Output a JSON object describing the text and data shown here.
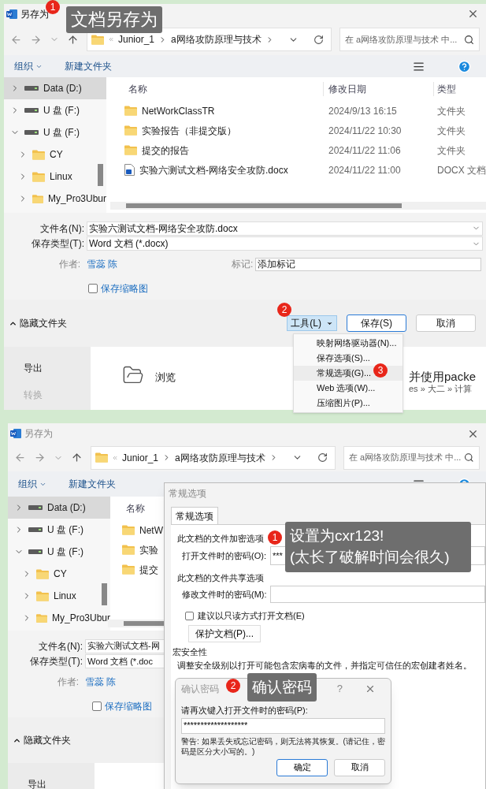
{
  "step1": {
    "dialog": {
      "title": "另存为",
      "path": [
        "Junior_1",
        "a网络攻防原理与技术"
      ],
      "search_placeholder": "在 a网络攻防原理与技术 中...",
      "organize": "组织",
      "new_folder": "新建文件夹",
      "tree": [
        {
          "label": "Data (D:)",
          "kind": "drive",
          "selected": true,
          "expanded": false
        },
        {
          "label": "U 盘 (F:)",
          "kind": "drive",
          "selected": false,
          "expanded": false
        },
        {
          "label": "U 盘 (F:)",
          "kind": "drive",
          "selected": false,
          "expanded": true,
          "children": [
            {
              "label": "CY",
              "kind": "folder",
              "selected": false,
              "expanded": false
            },
            {
              "label": "Linux",
              "kind": "folder",
              "selected": false,
              "expanded": false
            },
            {
              "label": "My_Pro3Ubur",
              "kind": "folder",
              "selected": false,
              "expanded": false
            }
          ]
        }
      ],
      "columns": [
        "名称",
        "修改日期",
        "类型"
      ],
      "files": [
        {
          "kind": "folder",
          "name": "NetWorkClassTR",
          "date": "2024/9/13 16:15",
          "type": "文件夹"
        },
        {
          "kind": "folder",
          "name": "实验报告（非提交版）",
          "date": "2024/11/22 10:30",
          "type": "文件夹"
        },
        {
          "kind": "folder",
          "name": "提交的报告",
          "date": "2024/11/22 11:06",
          "type": "文件夹"
        },
        {
          "kind": "docx",
          "name": "实验六测试文档-网络安全攻防.docx",
          "date": "2024/11/22 11:00",
          "type": "DOCX 文档"
        }
      ],
      "filename_label": "文件名(N):",
      "filename": "实验六测试文档-网络安全攻防.docx",
      "filetype_label": "保存类型(T):",
      "filetype": "Word 文档 (*.docx)",
      "author_label": "作者:",
      "author": "雪蕊 陈",
      "tags_label": "标记:",
      "tags_placeholder": "添加标记",
      "thumbnail": {
        "label": "保存缩略图",
        "checked": false
      },
      "hide_folders": "隐藏文件夹",
      "tools": "工具(L)",
      "save": "保存(S)",
      "cancel": "取消"
    },
    "background": {
      "menu": [
        {
          "label": "导出",
          "disabled": false
        },
        {
          "label": "转换",
          "disabled": true
        }
      ],
      "browse": "浏览",
      "recent_title": "并使用packe",
      "recent_path": "es » 大二 » 计算"
    },
    "tools_menu": [
      {
        "label": "映射网络驱动器(N)...",
        "selected": false
      },
      {
        "label": "保存选项(S)...",
        "selected": false
      },
      {
        "label": "常规选项(G)...",
        "selected": true
      },
      {
        "label": "Web 选项(W)...",
        "selected": false
      },
      {
        "label": "压缩图片(P)...",
        "selected": false
      }
    ],
    "callouts": [
      {
        "number": "1",
        "lines": [
          "文档另存为"
        ]
      },
      {
        "number": "2"
      },
      {
        "number": "3"
      }
    ]
  },
  "step2": {
    "dialog": {
      "title": "另存为",
      "path": [
        "Junior_1",
        "a网络攻防原理与技术"
      ],
      "search_placeholder": "在 a网络攻防原理与技术 中...",
      "organize": "组织",
      "new_folder": "新建文件夹",
      "tree": [
        {
          "label": "Data (D:)",
          "kind": "drive",
          "selected": true,
          "expanded": false
        },
        {
          "label": "U 盘 (F:)",
          "kind": "drive",
          "selected": false,
          "expanded": false
        },
        {
          "label": "U 盘 (F:)",
          "kind": "drive",
          "selected": false,
          "expanded": true,
          "children": [
            {
              "label": "CY",
              "kind": "folder",
              "selected": false,
              "expanded": false
            },
            {
              "label": "Linux",
              "kind": "folder",
              "selected": false,
              "expanded": false
            },
            {
              "label": "My_Pro3Ubur",
              "kind": "folder",
              "selected": false,
              "expanded": false
            }
          ]
        }
      ],
      "columns": [
        "名称"
      ],
      "files": [
        {
          "kind": "folder",
          "name": "NetW"
        },
        {
          "kind": "folder",
          "name": "实验"
        },
        {
          "kind": "folder",
          "name": "提交"
        }
      ],
      "filename_label": "文件名(N):",
      "filename": "实验六测试文档-网",
      "filetype_label": "保存类型(T):",
      "filetype": "Word 文档 (*.doc",
      "author_label": "作者:",
      "author": "雪蕊 陈",
      "thumbnail": {
        "label": "保存缩略图",
        "checked": false
      },
      "hide_folders": "隐藏文件夹"
    },
    "background": {
      "menu": [
        {
          "label": "导出",
          "disabled": false
        }
      ]
    },
    "general_options": {
      "title": "常规选项",
      "tabs": [
        {
          "label": "常规选项",
          "selected": true
        }
      ],
      "encryption_heading": "此文档的文件加密选项",
      "open_password_label": "打开文件时的密码(O):",
      "open_password": "***",
      "sharing_heading": "此文档的文件共享选项",
      "modify_password_label": "修改文件时的密码(M):",
      "read_only": {
        "label": "建议以只读方式打开文档(E)",
        "checked": false
      },
      "protect_button": "保护文档(P)...",
      "macro_heading": "宏安全性",
      "macro_text": "调整安全级别以打开可能包含宏病毒的文件，并指定可信任的宏创建者姓名。"
    },
    "confirm_password": {
      "title": "确认密码",
      "help": "?",
      "label": "请再次键入打开文件时的密码(P):",
      "value": "*******************",
      "warning": "警告: 如果丢失或忘记密码，则无法将其恢复。(请记住，密码是区分大小写的。)",
      "ok": "确定",
      "cancel": "取消"
    },
    "callouts": [
      {
        "number": "1",
        "lines": [
          "设置为cxr123!",
          "(太长了破解时间会很久)"
        ]
      },
      {
        "number": "2",
        "lines": [
          "确认密码"
        ]
      }
    ]
  }
}
